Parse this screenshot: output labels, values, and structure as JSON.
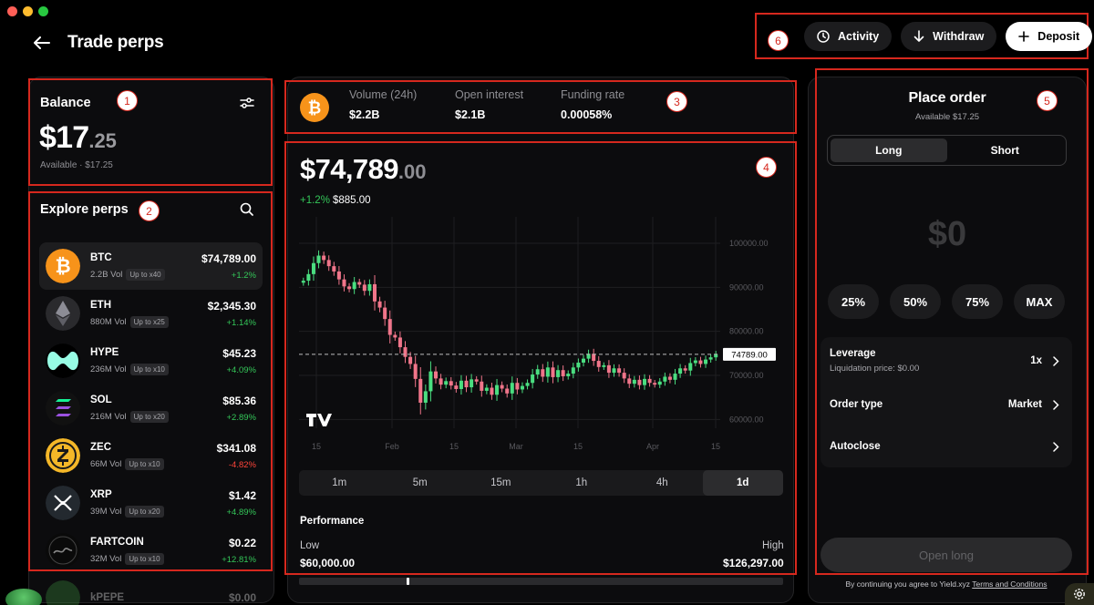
{
  "window": {
    "traffic_colors": [
      "#ff5f57",
      "#febc2e",
      "#28c840"
    ]
  },
  "header": {
    "title": "Trade perps"
  },
  "actions": {
    "activity": "Activity",
    "withdraw": "Withdraw",
    "deposit": "Deposit"
  },
  "markers": [
    "1",
    "2",
    "3",
    "4",
    "5",
    "6"
  ],
  "balance": {
    "title": "Balance",
    "whole": "$17",
    "cents": ".25",
    "available": "Available · $17.25"
  },
  "explore": {
    "title": "Explore perps",
    "assets": [
      {
        "symbol": "BTC",
        "volume": "2.2B Vol",
        "leverage": "Up to x40",
        "price": "$74,789.00",
        "change": "+1.2%",
        "direction": "up"
      },
      {
        "symbol": "ETH",
        "volume": "880M Vol",
        "leverage": "Up to x25",
        "price": "$2,345.30",
        "change": "+1.14%",
        "direction": "up"
      },
      {
        "symbol": "HYPE",
        "volume": "236M Vol",
        "leverage": "Up to x10",
        "price": "$45.23",
        "change": "+4.09%",
        "direction": "up"
      },
      {
        "symbol": "SOL",
        "volume": "216M Vol",
        "leverage": "Up to x20",
        "price": "$85.36",
        "change": "+2.89%",
        "direction": "up"
      },
      {
        "symbol": "ZEC",
        "volume": "66M Vol",
        "leverage": "Up to x10",
        "price": "$341.08",
        "change": "-4.82%",
        "direction": "down"
      },
      {
        "symbol": "XRP",
        "volume": "39M Vol",
        "leverage": "Up to x20",
        "price": "$1.42",
        "change": "+4.89%",
        "direction": "up"
      },
      {
        "symbol": "FARTCOIN",
        "volume": "32M Vol",
        "leverage": "Up to x10",
        "price": "$0.22",
        "change": "+12.81%",
        "direction": "up"
      },
      {
        "symbol": "kPEPE",
        "volume": "",
        "leverage": "",
        "price": "$0.00",
        "change": "",
        "direction": "up"
      }
    ]
  },
  "stats": {
    "volume_label": "Volume (24h)",
    "volume_value": "$2.2B",
    "oi_label": "Open interest",
    "oi_value": "$2.1B",
    "funding_label": "Funding rate",
    "funding_value": "0.00058%"
  },
  "price": {
    "whole": "$74,789",
    "cents": ".00",
    "change_pct": "+1.2%",
    "change_abs": "$885.00"
  },
  "chart_data": {
    "type": "candlestick",
    "y_ticks": [
      "100000.00",
      "90000.00",
      "80000.00",
      "70000.00",
      "60000.00"
    ],
    "x_ticks": [
      "15",
      "Feb",
      "15",
      "Mar",
      "15",
      "Apr",
      "15"
    ],
    "ylim": [
      58000,
      106000
    ],
    "current_price_label": "74789.00",
    "current_price": 74789,
    "grid": true,
    "closes": [
      91500,
      93000,
      95500,
      97200,
      96200,
      94800,
      93600,
      91800,
      90200,
      89600,
      91200,
      90600,
      89200,
      90700,
      86800,
      85400,
      82800,
      79200,
      78600,
      76400,
      74200,
      72600,
      69200,
      63800,
      66400,
      70900,
      69300,
      67900,
      68700,
      67700,
      66900,
      68800,
      67300,
      69100,
      68600,
      66500,
      67200,
      65600,
      67800,
      67000,
      65900,
      68300,
      66800,
      67600,
      68300,
      70200,
      71400,
      69700,
      71800,
      69600,
      71200,
      69800,
      70400,
      71800,
      72900,
      73800,
      74900,
      73300,
      71900,
      72300,
      70600,
      71600,
      70600,
      69300,
      68100,
      69000,
      67800,
      69200,
      68300,
      67900,
      68600,
      69700,
      69000,
      70400,
      71600,
      71100,
      72800,
      73400,
      72600,
      73600,
      74100,
      74789
    ]
  },
  "timeframes": {
    "items": [
      "1m",
      "5m",
      "15m",
      "1h",
      "4h",
      "1d"
    ],
    "active": "1d"
  },
  "performance": {
    "title": "Performance",
    "low_label": "Low",
    "high_label": "High",
    "low_value": "$60,000.00",
    "high_value": "$126,297.00"
  },
  "order": {
    "title": "Place order",
    "available": "Available $17.25",
    "long": "Long",
    "short": "Short",
    "amount": "$0",
    "percents": [
      "25%",
      "50%",
      "75%",
      "MAX"
    ],
    "leverage_label": "Leverage",
    "liquidation": "Liquidation price: $0.00",
    "leverage_value": "1x",
    "order_type_label": "Order type",
    "order_type_value": "Market",
    "autoclose_label": "Autoclose",
    "submit": "Open long",
    "terms_prefix": "By continuing you agree to Yield.xyz ",
    "terms_link": "Terms and Conditions"
  },
  "colors": {
    "accent_red": "#d6281e",
    "up": "#34c759",
    "down": "#ff453a",
    "candle_up": "#4ade80",
    "candle_down": "#f0758a"
  }
}
